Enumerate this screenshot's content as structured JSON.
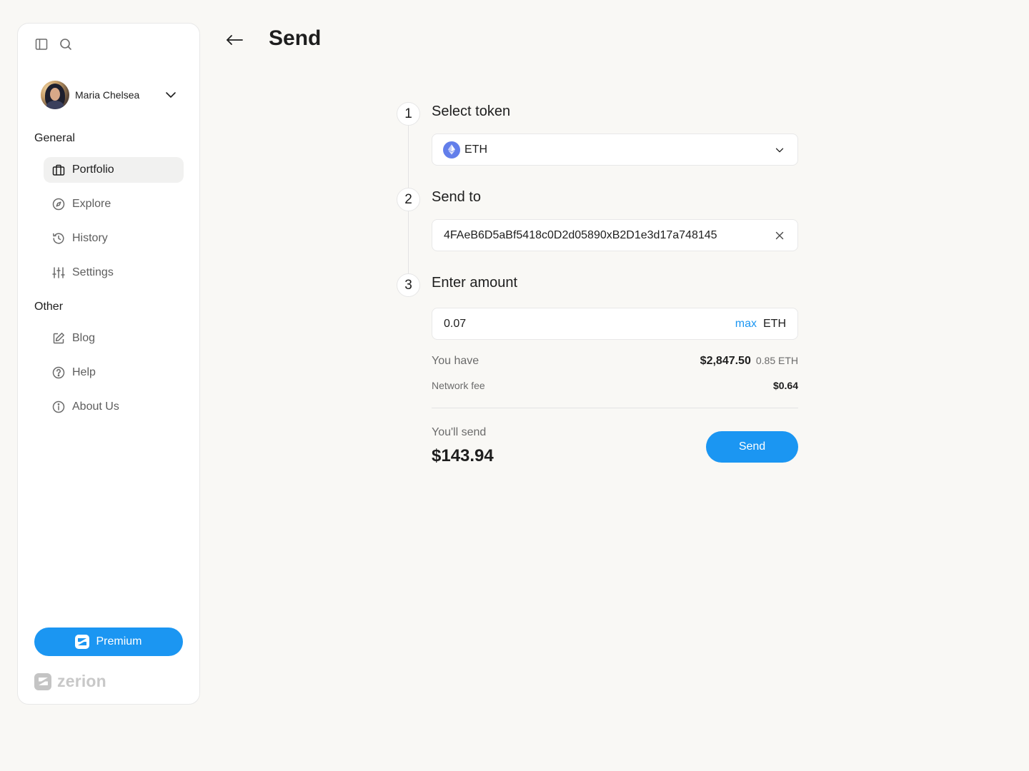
{
  "sidebar": {
    "user_name": "Maria Chelsea",
    "general_title": "General",
    "general_items": [
      {
        "label": "Portfolio",
        "icon": "briefcase-icon"
      },
      {
        "label": "Explore",
        "icon": "compass-icon"
      },
      {
        "label": "History",
        "icon": "history-icon"
      },
      {
        "label": "Settings",
        "icon": "sliders-icon"
      }
    ],
    "other_title": "Other",
    "other_items": [
      {
        "label": "Blog",
        "icon": "edit-icon"
      },
      {
        "label": "Help",
        "icon": "help-circle-icon"
      },
      {
        "label": "About Us",
        "icon": "info-icon"
      }
    ],
    "premium_label": "Premium",
    "brand_name": "zerion"
  },
  "header": {
    "title": "Send"
  },
  "steps": [
    {
      "number": "1",
      "title": "Select token"
    },
    {
      "number": "2",
      "title": "Send to"
    },
    {
      "number": "3",
      "title": "Enter amount"
    }
  ],
  "token": {
    "symbol": "ETH"
  },
  "recipient": {
    "address": "4FAeB6D5aBf5418c0D2d05890xB2D1e3d17a748145"
  },
  "amount": {
    "value": "0.07",
    "max_label": "max",
    "unit": "ETH"
  },
  "balance": {
    "label": "You have",
    "usd": "$2,847.50",
    "token_amount": "0.85 ETH"
  },
  "fee": {
    "label": "Network fee",
    "value": "$0.64"
  },
  "summary": {
    "label": "You'll send",
    "value": "$143.94",
    "send_label": "Send"
  },
  "colors": {
    "accent": "#1B96F2",
    "eth": "#627EEA",
    "background": "#F9F8F5"
  }
}
